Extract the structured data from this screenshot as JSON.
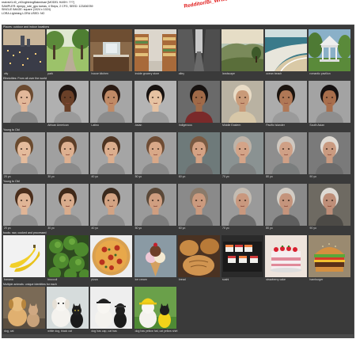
{
  "header": {
    "lines": [
      "realvisXL40_v40LightningBakedvae [MODEL HASH: ???]",
      "SAMPLER: dpmpp_sde_gpu karras, 4 Steps, 2 CFG, SEED: 123456789",
      "SINGLE IMAGE: square (1024 x 1024)",
      "LORA:Lightning LORA USED: NO"
    ],
    "watermark": "Redditor/Bi_Wrwe"
  },
  "sections": [
    {
      "title": "Places: outdoor and indoor locations",
      "items": [
        {
          "caption": "city",
          "kind": "city"
        },
        {
          "caption": "park",
          "kind": "park"
        },
        {
          "caption": "house kitchen",
          "kind": "kitchen"
        },
        {
          "caption": "inside grocery store",
          "kind": "grocery"
        },
        {
          "caption": "alley",
          "kind": "alley"
        },
        {
          "caption": "landscape",
          "kind": "landscape"
        },
        {
          "caption": "ocean beach",
          "kind": "beach"
        },
        {
          "caption": "romantic pavilion",
          "kind": "pavilion"
        }
      ]
    },
    {
      "title": "Ethnicities: From all over the world",
      "items": [
        {
          "caption": "",
          "kind": "portrait",
          "skin": "#e2b89a",
          "hair": "#6b4a30",
          "shirt": "#8a8a8a",
          "bg": "#a9a9a9"
        },
        {
          "caption": "African American",
          "kind": "portrait",
          "skin": "#6a4028",
          "hair": "#1e1410",
          "shirt": "#9a9a9a",
          "bg": "#b0b0b0"
        },
        {
          "caption": "Latino",
          "kind": "portrait",
          "skin": "#c08a66",
          "hair": "#2a1a12",
          "shirt": "#8c8c8c",
          "bg": "#a6a6a6"
        },
        {
          "caption": "Asian",
          "kind": "portrait",
          "skin": "#e6c2a2",
          "hair": "#171210",
          "shirt": "#9a9a9a",
          "bg": "#b4b4b4"
        },
        {
          "caption": "Indigenous",
          "kind": "portrait",
          "skin": "#a06a48",
          "hair": "#171210",
          "shirt": "#7a2a2a",
          "bg": "#6a6a6a"
        },
        {
          "caption": "Middle Eastern",
          "kind": "portrait",
          "skin": "#c99a78",
          "hair": "#e9dcc6",
          "shirt": "#d7c7a8",
          "bg": "#b9b2a2"
        },
        {
          "caption": "Pacific Islander",
          "kind": "portrait",
          "skin": "#b07856",
          "hair": "#1b140f",
          "shirt": "#9a9a9a",
          "bg": "#acacac"
        },
        {
          "caption": "South Asian",
          "kind": "portrait",
          "skin": "#a86e4c",
          "hair": "#151010",
          "shirt": "#8e8e8e",
          "bg": "#a3a3a3"
        }
      ]
    },
    {
      "title": "Young to Old",
      "items": [
        {
          "caption": "20 yo",
          "kind": "portrait",
          "skin": "#e4bb9c",
          "hair": "#6a4a2e",
          "shirt": "#8e8e8e",
          "bg": "#a3a3a3"
        },
        {
          "caption": "30 yo",
          "kind": "portrait",
          "skin": "#deb090",
          "hair": "#5c3e28",
          "shirt": "#8a8a8a",
          "bg": "#a0a0a0"
        },
        {
          "caption": "40 yo",
          "kind": "portrait",
          "skin": "#dcae8e",
          "hair": "#4e3422",
          "shirt": "#8a8a8a",
          "bg": "#a5a5a5"
        },
        {
          "caption": "50 yo",
          "kind": "portrait",
          "skin": "#d8a888",
          "hair": "#6e4c34",
          "shirt": "#888",
          "bg": "#a0a0a0"
        },
        {
          "caption": "60 yo",
          "kind": "portrait",
          "skin": "#d4a284",
          "hair": "#7a5a42",
          "shirt": "#6a6a6a",
          "bg": "#6e7a7a"
        },
        {
          "caption": "70 yo",
          "kind": "portrait",
          "skin": "#d4a488",
          "hair": "#bdb3a8",
          "shirt": "#7d8080",
          "bg": "#8a9292"
        },
        {
          "caption": "80 yo",
          "kind": "portrait",
          "skin": "#cfa086",
          "hair": "#cfc8c0",
          "shirt": "#7a7d7d",
          "bg": "#8e8e8e"
        },
        {
          "caption": "90 yo",
          "kind": "portrait",
          "skin": "#c99a80",
          "hair": "#e0dbd4",
          "shirt": "#6c6c6c",
          "bg": "#7a7a7a"
        }
      ]
    },
    {
      "title": "Young to Old",
      "items": [
        {
          "caption": "20 yo",
          "kind": "portrait",
          "skin": "#e0b596",
          "hair": "#4a2e1c",
          "shirt": "#8e8e8e",
          "bg": "#a8a8a8"
        },
        {
          "caption": "30 yo",
          "kind": "portrait",
          "skin": "#d9ac8c",
          "hair": "#3e2818",
          "shirt": "#8a8a8a",
          "bg": "#a2a2a2"
        },
        {
          "caption": "40 yo",
          "kind": "portrait",
          "skin": "#d3a383",
          "hair": "#3a2a1e",
          "shirt": "#8a8a8a",
          "bg": "#a6a6a6"
        },
        {
          "caption": "50 yo",
          "kind": "portrait",
          "skin": "#cf9e80",
          "hair": "#5a4838",
          "shirt": "#7c7c7c",
          "bg": "#9a9a9a"
        },
        {
          "caption": "60 yo",
          "kind": "portrait",
          "skin": "#cb9a7e",
          "hair": "#8a7a6a",
          "shirt": "#6a6a6a",
          "bg": "#8a8a8a"
        },
        {
          "caption": "70 yo",
          "kind": "portrait",
          "skin": "#c9987e",
          "hair": "#c4bcb2",
          "shirt": "#6c6c6c",
          "bg": "#9a9a9a"
        },
        {
          "caption": "80 yo",
          "kind": "portrait",
          "skin": "#c4947c",
          "hair": "#d2ccc4",
          "shirt": "#5e5e5e",
          "bg": "#8a8a8a"
        },
        {
          "caption": "90 yo",
          "kind": "portrait",
          "skin": "#be8e78",
          "hair": "#dedad4",
          "shirt": "#4c4a46",
          "bg": "#6e6a62"
        }
      ]
    },
    {
      "title": "foods: raw, cooked and processed",
      "items": [
        {
          "caption": "banana",
          "kind": "banana"
        },
        {
          "caption": "broccoli",
          "kind": "broccoli"
        },
        {
          "caption": "pizza",
          "kind": "pizza"
        },
        {
          "caption": "ice cream",
          "kind": "icecream"
        },
        {
          "caption": "bread",
          "kind": "bread"
        },
        {
          "caption": "sushi",
          "kind": "sushi"
        },
        {
          "caption": "strawberry cake",
          "kind": "cake"
        },
        {
          "caption": "hamburger",
          "kind": "burger"
        }
      ]
    },
    {
      "title": "Multiple animals: unique identities for each",
      "items": [
        {
          "caption": "dog, cat",
          "kind": "dogcat"
        },
        {
          "caption": "white dog, black cat",
          "kind": "whitedog"
        },
        {
          "caption": "dog has cap, cat has",
          "kind": "caps"
        },
        {
          "caption": "dog has yellow hat, cat yellow shirt",
          "kind": "yellow"
        }
      ]
    }
  ]
}
